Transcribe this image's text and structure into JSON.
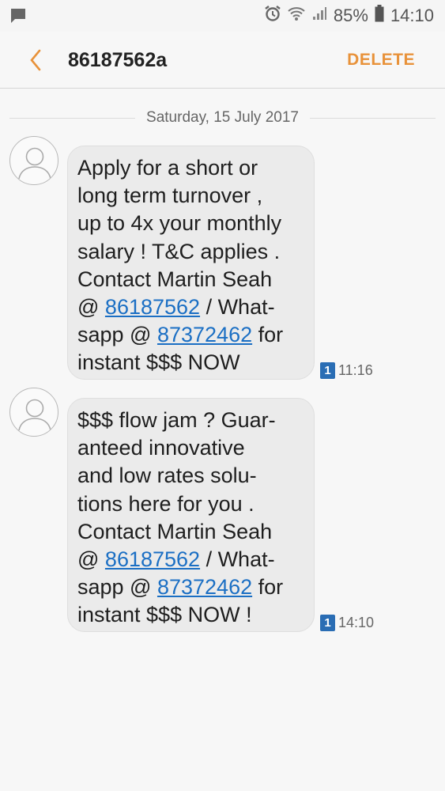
{
  "status_bar": {
    "battery_percent": "85%",
    "time": "14:10",
    "icons": [
      "message-notification-icon",
      "alarm-icon",
      "wifi-icon",
      "signal-icon",
      "battery-icon"
    ]
  },
  "app_bar": {
    "title": "86187562a",
    "delete_label": "DELETE",
    "accent_color": "#e8923a"
  },
  "date_separator": "Saturday, 15 July 2017",
  "messages": [
    {
      "lines": [
        "Apply for a short or",
        "long term turnover ,",
        "up to 4x your monthly",
        "salary ! T&C applies .",
        "Contact Martin Seah"
      ],
      "line6_prefix": "@ ",
      "link1": "86187562",
      "line6_suffix": " / What-",
      "line7_prefix": "sapp @ ",
      "link2": "87372462",
      "line7_suffix": " for",
      "last_line": "instant $$$ NOW",
      "sim": "1",
      "time": "11:16"
    },
    {
      "lines": [
        "$$$ flow jam ? Guar-",
        "anteed innovative",
        "and low rates solu-",
        "tions here for you .",
        "Contact Martin Seah"
      ],
      "line6_prefix": "@ ",
      "link1": "86187562",
      "line6_suffix": " / What-",
      "line7_prefix": "sapp @ ",
      "link2": "87372462",
      "line7_suffix": " for",
      "last_line": "instant $$$ NOW !",
      "sim": "1",
      "time": "14:10"
    }
  ]
}
